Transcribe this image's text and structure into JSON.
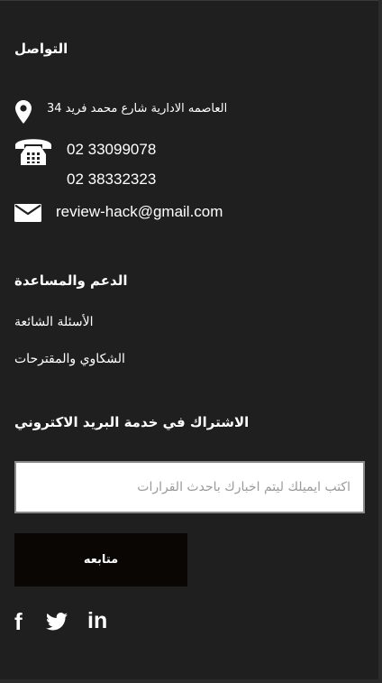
{
  "contact": {
    "heading": "التواصل",
    "address": "العاصمه الادارية شارع محمد فريد 34",
    "phone_1": "02 33099078",
    "phone_2": "02 38332323",
    "email": "review-hack@gmail.com",
    "icons": [
      "map-pin-icon",
      "telephone-icon",
      "envelope-icon"
    ]
  },
  "support": {
    "heading": "الدعم والمساعدة",
    "links": [
      "الأسئلة الشائعة",
      "الشكاوي والمقترحات"
    ]
  },
  "newsletter": {
    "heading": "الاشتراك في خدمة البريد الاكتروني",
    "placeholder": "اكتب ايميلك ليتم اخبارك باحدث القرارات",
    "value": "",
    "button_label": "متابعه"
  },
  "social": {
    "facebook_label": "f",
    "linkedin_label": "in",
    "icons": [
      "facebook-icon",
      "twitter-icon",
      "linkedin-icon"
    ]
  },
  "colors": {
    "panel_bg": "#1f1f1f",
    "page_bg": "#2b2b2b",
    "button_bg": "#0a0604",
    "text": "#ffffff"
  }
}
